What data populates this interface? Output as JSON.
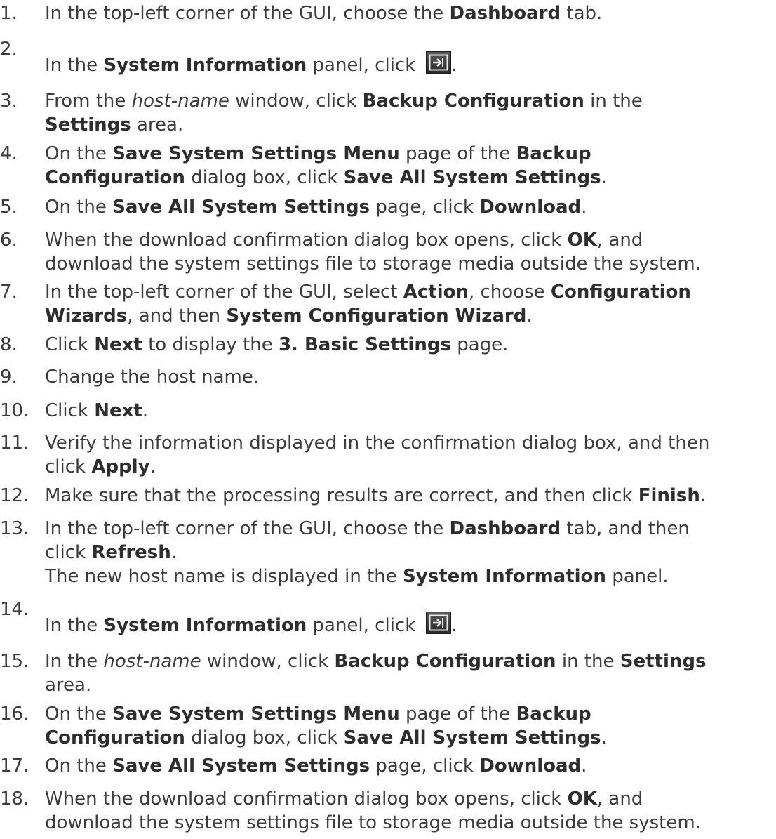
{
  "steps": [
    {
      "n": "1.",
      "lines": [
        [
          {
            "t": "In the top-left corner of the GUI, choose the "
          },
          {
            "t": "Dashboard",
            "b": true
          },
          {
            "t": " tab."
          }
        ]
      ]
    },
    {
      "n": "2.",
      "number_alone": true,
      "lines": [
        [
          {
            "t": "In the "
          },
          {
            "t": "System Information",
            "b": true
          },
          {
            "t": " panel, click "
          },
          {
            "icon": "panel-open-icon"
          },
          {
            "t": "."
          }
        ]
      ]
    },
    {
      "n": "3.",
      "lines": [
        [
          {
            "t": "From the "
          },
          {
            "t": "host-name",
            "i": true
          },
          {
            "t": " window, click "
          },
          {
            "t": "Backup Configuration",
            "b": true
          },
          {
            "t": " in the"
          }
        ],
        [
          {
            "t": "Settings",
            "b": true
          },
          {
            "t": " area."
          }
        ]
      ]
    },
    {
      "n": "4.",
      "lines": [
        [
          {
            "t": "On the "
          },
          {
            "t": "Save System Settings Menu",
            "b": true
          },
          {
            "t": " page of the "
          },
          {
            "t": "Backup",
            "b": true
          }
        ],
        [
          {
            "t": "Configuration",
            "b": true
          },
          {
            "t": " dialog box, click "
          },
          {
            "t": "Save All System Settings",
            "b": true
          },
          {
            "t": "."
          }
        ]
      ]
    },
    {
      "n": "5.",
      "lines": [
        [
          {
            "t": "On the "
          },
          {
            "t": "Save All System Settings",
            "b": true
          },
          {
            "t": " page, click "
          },
          {
            "t": "Download",
            "b": true
          },
          {
            "t": "."
          }
        ]
      ]
    },
    {
      "n": "6.",
      "lines": [
        [
          {
            "t": "When the download confirmation dialog box opens, click "
          },
          {
            "t": "OK",
            "b": true
          },
          {
            "t": ", and"
          }
        ],
        [
          {
            "t": "download the system settings file to storage media outside the system."
          }
        ]
      ]
    },
    {
      "n": "7.",
      "lines": [
        [
          {
            "t": "In the top-left corner of the GUI, select "
          },
          {
            "t": "Action",
            "b": true
          },
          {
            "t": ", choose "
          },
          {
            "t": "Configuration",
            "b": true
          }
        ],
        [
          {
            "t": "Wizards",
            "b": true
          },
          {
            "t": ", and then "
          },
          {
            "t": "System Configuration Wizard",
            "b": true
          },
          {
            "t": "."
          }
        ]
      ]
    },
    {
      "n": "8.",
      "lines": [
        [
          {
            "t": "Click "
          },
          {
            "t": "Next",
            "b": true
          },
          {
            "t": " to display the "
          },
          {
            "t": "3. Basic Settings",
            "b": true
          },
          {
            "t": " page."
          }
        ]
      ]
    },
    {
      "n": "9.",
      "lines": [
        [
          {
            "t": "Change the host name."
          }
        ]
      ]
    },
    {
      "n": "10.",
      "lines": [
        [
          {
            "t": "Click "
          },
          {
            "t": "Next",
            "b": true
          },
          {
            "t": "."
          }
        ]
      ]
    },
    {
      "n": "11.",
      "lines": [
        [
          {
            "t": "Verify the information displayed in the confirmation dialog box, and then"
          }
        ],
        [
          {
            "t": "click "
          },
          {
            "t": "Apply",
            "b": true
          },
          {
            "t": "."
          }
        ]
      ]
    },
    {
      "n": "12.",
      "lines": [
        [
          {
            "t": "Make sure that the processing results are correct, and then click "
          },
          {
            "t": "Finish",
            "b": true
          },
          {
            "t": "."
          }
        ]
      ]
    },
    {
      "n": "13.",
      "lines": [
        [
          {
            "t": "In the top-left corner of the GUI, choose the "
          },
          {
            "t": "Dashboard",
            "b": true
          },
          {
            "t": " tab, and then"
          }
        ],
        [
          {
            "t": "click "
          },
          {
            "t": "Refresh",
            "b": true
          },
          {
            "t": "."
          }
        ],
        [
          {
            "t": "The new host name is displayed in the "
          },
          {
            "t": "System Information",
            "b": true
          },
          {
            "t": " panel."
          }
        ]
      ]
    },
    {
      "n": "14.",
      "number_alone": true,
      "lines": [
        [
          {
            "t": "In the "
          },
          {
            "t": "System Information",
            "b": true
          },
          {
            "t": " panel, click "
          },
          {
            "icon": "panel-open-icon"
          },
          {
            "t": "."
          }
        ]
      ]
    },
    {
      "n": "15.",
      "lines": [
        [
          {
            "t": "In the "
          },
          {
            "t": "host-name",
            "i": true
          },
          {
            "t": " window, click "
          },
          {
            "t": "Backup Configuration",
            "b": true
          },
          {
            "t": " in the "
          },
          {
            "t": "Settings",
            "b": true
          }
        ],
        [
          {
            "t": "area."
          }
        ]
      ]
    },
    {
      "n": "16.",
      "lines": [
        [
          {
            "t": "On the "
          },
          {
            "t": "Save System Settings Menu",
            "b": true
          },
          {
            "t": " page of the "
          },
          {
            "t": "Backup",
            "b": true
          }
        ],
        [
          {
            "t": "Configuration",
            "b": true
          },
          {
            "t": " dialog box, click "
          },
          {
            "t": "Save All System Settings",
            "b": true
          },
          {
            "t": "."
          }
        ]
      ]
    },
    {
      "n": "17.",
      "lines": [
        [
          {
            "t": "On the "
          },
          {
            "t": "Save All System Settings",
            "b": true
          },
          {
            "t": " page, click "
          },
          {
            "t": "Download",
            "b": true
          },
          {
            "t": "."
          }
        ]
      ]
    },
    {
      "n": "18.",
      "lines": [
        [
          {
            "t": "When the download confirmation dialog box opens, click "
          },
          {
            "t": "OK",
            "b": true
          },
          {
            "t": ", and"
          }
        ],
        [
          {
            "t": "download the system settings file to storage media outside the system."
          }
        ]
      ]
    }
  ]
}
